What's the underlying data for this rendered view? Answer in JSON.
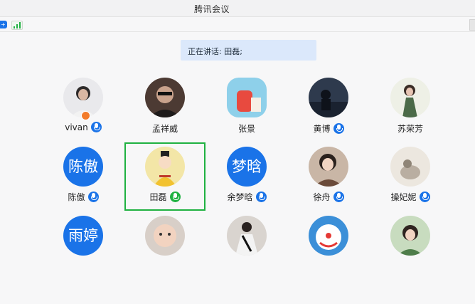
{
  "window": {
    "title": "腾讯会议"
  },
  "speaking_banner": {
    "text": "正在讲话: 田磊;"
  },
  "participants": [
    {
      "name": "vivan",
      "mic": true,
      "host": true,
      "avatar": "photo-woman"
    },
    {
      "name": "孟祥威",
      "mic": false,
      "avatar": "photo-man-sunglasses"
    },
    {
      "name": "张景",
      "mic": false,
      "avatar": "photo-red-cup"
    },
    {
      "name": "黄博",
      "mic": true,
      "avatar": "photo-night-man"
    },
    {
      "name": "苏荣芳",
      "mic": false,
      "avatar": "photo-girl-dress"
    },
    {
      "name": "陈傲",
      "mic": true,
      "avatar_text": "陈傲",
      "avatar": "text"
    },
    {
      "name": "田磊",
      "mic": true,
      "active": true,
      "avatar": "cartoon-emperor"
    },
    {
      "name": "余梦晗",
      "mic": true,
      "avatar_text": "梦晗",
      "avatar": "text"
    },
    {
      "name": "徐舟",
      "mic": true,
      "avatar": "photo-woman-hand"
    },
    {
      "name": "操妃妮",
      "mic": true,
      "avatar": "painting-gray"
    },
    {
      "name": "",
      "avatar_text": "雨婷",
      "avatar": "text"
    },
    {
      "name": "",
      "avatar": "photo-baby"
    },
    {
      "name": "",
      "avatar": "photo-man-suit"
    },
    {
      "name": "",
      "avatar": "cartoon-doraemon"
    },
    {
      "name": "",
      "avatar": "photo-woman-green"
    }
  ],
  "colors": {
    "accent": "#1a73e8",
    "active_border": "#1fb141",
    "banner": "#dbe8fb"
  }
}
